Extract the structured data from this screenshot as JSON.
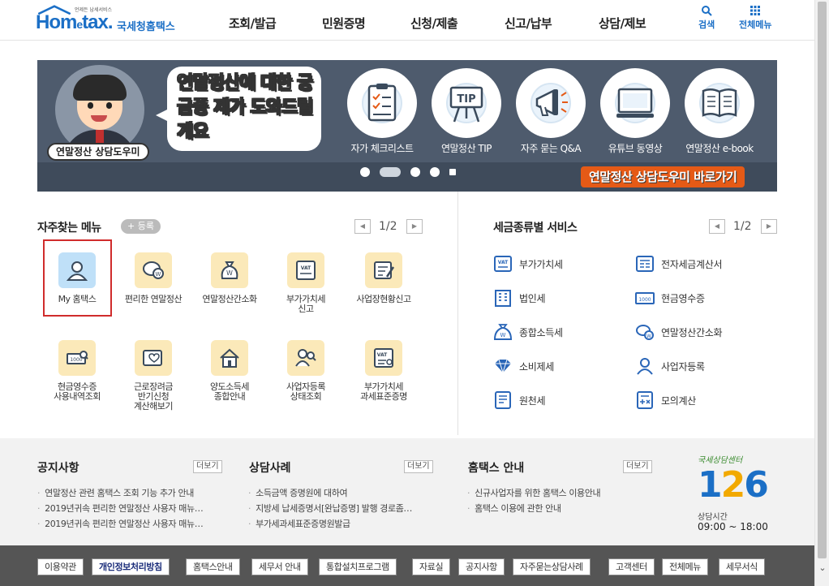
{
  "header": {
    "logo_sub": "언제든 납세서비스",
    "logo_home": "Hom",
    "logo_e": "e",
    "logo_tax": "tax.",
    "logo_ko": "국세청홈택스",
    "nav": [
      "조회/발급",
      "민원증명",
      "신청/제출",
      "신고/납부",
      "상담/제보"
    ],
    "search_label": "검색",
    "allmenu_label": "전체메뉴"
  },
  "banner": {
    "bubble_text": "연말정산에 대한 궁금증 제가 도와드릴게요",
    "mascot_label": "연말정산 상담도우미",
    "items": [
      "자가 체크리스트",
      "연말정산 TIP",
      "자주 묻는 Q&A",
      "유튜브 동영상",
      "연말정산 e-book"
    ],
    "tip_text": "TIP",
    "link_label": "연말정산 상담도우미 바로가기",
    "active_slide": 2,
    "slide_count": 5
  },
  "quick_menu": {
    "title": "자주찾는 메뉴",
    "register_label": "+ 등록",
    "page": "1/2",
    "items": [
      {
        "label": "My 홈택스",
        "icon": "user-icon"
      },
      {
        "label": "편리한 연말정산",
        "icon": "coin-icon"
      },
      {
        "label": "연말정산간소화",
        "icon": "money-bag-icon"
      },
      {
        "label": "부가가치세\n신고",
        "icon": "vat-icon"
      },
      {
        "label": "사업장현황신고",
        "icon": "report-icon"
      },
      {
        "label": "현금영수증\n사용내역조회",
        "icon": "receipt-icon"
      },
      {
        "label": "근로장려금\n반기신청\n계산해보기",
        "icon": "card-heart-icon"
      },
      {
        "label": "양도소득세\n종합안내",
        "icon": "house-icon"
      },
      {
        "label": "사업자등록\n상태조회",
        "icon": "people-search-icon"
      },
      {
        "label": "부가가치세\n과세표준증명",
        "icon": "vat-doc-icon"
      }
    ]
  },
  "tax_services": {
    "title": "세금종류별 서비스",
    "page": "1/2",
    "items": [
      {
        "label": "부가가치세",
        "icon": "vat-icon"
      },
      {
        "label": "전자세금계산서",
        "icon": "invoice-icon"
      },
      {
        "label": "법인세",
        "icon": "building-icon"
      },
      {
        "label": "현금영수증",
        "icon": "cash-receipt-icon"
      },
      {
        "label": "종합소득세",
        "icon": "money-bag-icon"
      },
      {
        "label": "연말정산간소화",
        "icon": "coin-icon"
      },
      {
        "label": "소비제세",
        "icon": "diamond-icon"
      },
      {
        "label": "사업자등록",
        "icon": "user-icon"
      },
      {
        "label": "원천세",
        "icon": "document-icon"
      },
      {
        "label": "모의계산",
        "icon": "calculator-icon"
      }
    ]
  },
  "news": {
    "more_label": "더보기",
    "sections": [
      {
        "title": "공지사항",
        "items": [
          "연말정산 관련 홈택스 조회 기능 추가 안내",
          "2019년귀속 편리한 연말정산 사용자 매뉴…",
          "2019년귀속 편리한 연말정산 사용자 매뉴…"
        ]
      },
      {
        "title": "상담사례",
        "items": [
          "소득금액 증명원에 대하여",
          "지방세 납세증명서[완납증명] 발행 경로좀…",
          "부가세과세표준증명원발급"
        ]
      },
      {
        "title": "홈택스 안내",
        "items": [
          "신규사업자를 위한 홈택스 이용안내",
          "홈택스 이용에 관한 안내"
        ]
      }
    ]
  },
  "call_center": {
    "caption": "국세상담센터",
    "digit1": "1",
    "digit2": "2",
    "digit3": "6",
    "hours_label": "상담시간",
    "hours": "09:00 ~ 18:00"
  },
  "footer": {
    "links": [
      "이용약관",
      "개인정보처리방침",
      "홈택스안내",
      "세무서 안내",
      "통합설치프로그램",
      "자료실",
      "공지사항",
      "자주묻는상담사례",
      "고객센터",
      "전체메뉴",
      "세무서식"
    ]
  },
  "colors": {
    "brand": "#1b6fc6",
    "banner_bg": "#4e5b6d",
    "accent_orange": "#e55a16",
    "selection_red": "#d02c2c"
  }
}
